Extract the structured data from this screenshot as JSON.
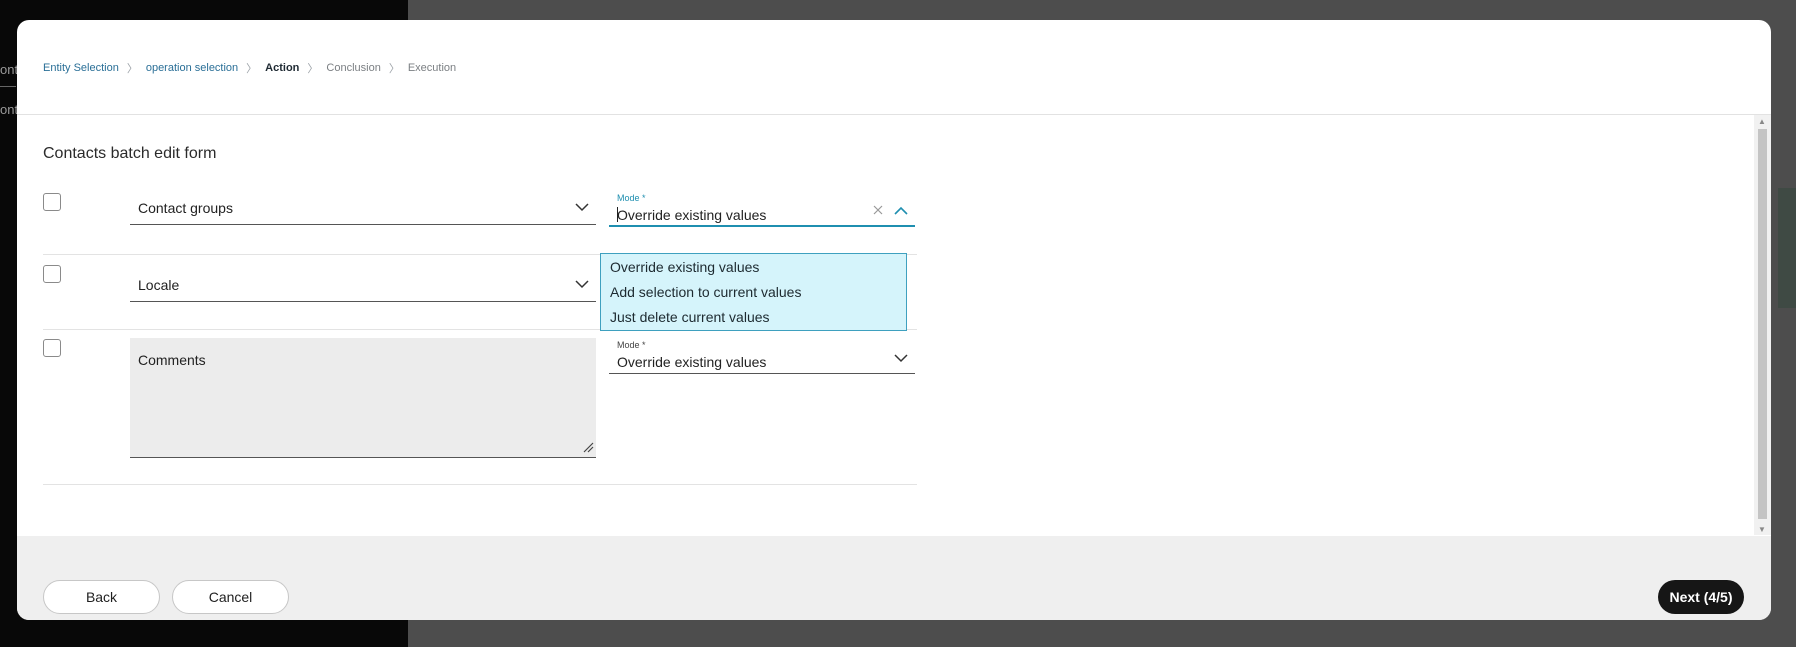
{
  "background": {
    "ghost_text_1": "ont",
    "ghost_text_2": "ont"
  },
  "breadcrumb": [
    {
      "label": "Entity Selection",
      "state": "done"
    },
    {
      "label": "operation selection",
      "state": "done"
    },
    {
      "label": "Action",
      "state": "current"
    },
    {
      "label": "Conclusion",
      "state": "future"
    },
    {
      "label": "Execution",
      "state": "future"
    }
  ],
  "form": {
    "title": "Contacts batch edit form",
    "rows": [
      {
        "field": "Contact groups",
        "mode_label": "Mode *",
        "mode_value": "Override existing values",
        "mode_open": true
      },
      {
        "field": "Locale"
      },
      {
        "field": "Comments",
        "mode_label": "Mode *",
        "mode_value": "Override existing values"
      }
    ],
    "mode_options": [
      "Override existing values",
      "Add selection to current values",
      "Just delete current values"
    ]
  },
  "footer": {
    "back_label": "Back",
    "cancel_label": "Cancel",
    "next_label": "Next (4/5)"
  },
  "colors": {
    "link": "#2a6f97",
    "accent": "#1f8fb0",
    "dropdown_bg": "#d5f4fb",
    "primary_button": "#161616"
  }
}
